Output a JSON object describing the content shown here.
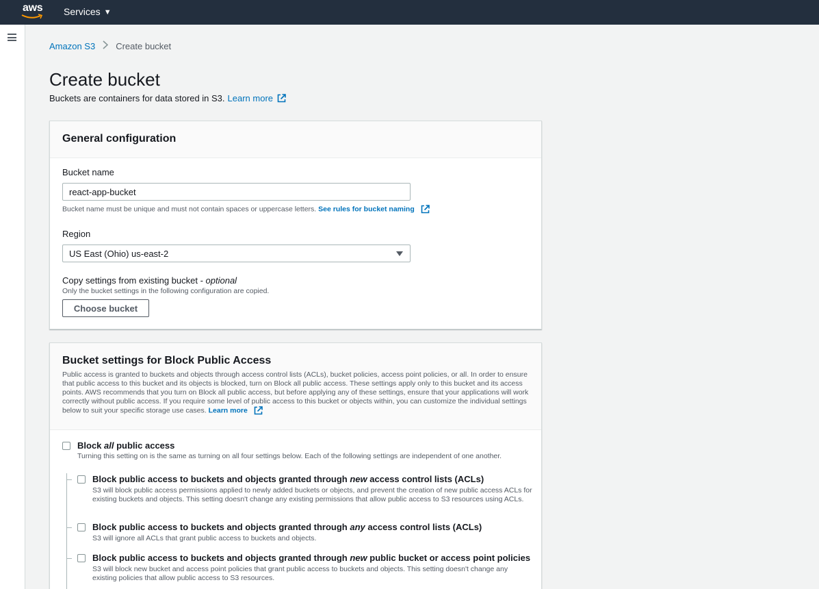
{
  "topbar": {
    "logo": "aws",
    "services_label": "Services"
  },
  "breadcrumb": {
    "root": "Amazon S3",
    "current": "Create bucket"
  },
  "page": {
    "title": "Create bucket",
    "description": "Buckets are containers for data stored in S3.",
    "learn_more": "Learn more"
  },
  "general": {
    "heading": "General configuration",
    "bucket_name_label": "Bucket name",
    "bucket_name_value": "react-app-bucket",
    "bucket_name_hint": "Bucket name must be unique and must not contain spaces or uppercase letters.",
    "bucket_name_rules_link": "See rules for bucket naming",
    "region_label": "Region",
    "region_value": "US East (Ohio) us-east-2",
    "copy_label": "Copy settings from existing bucket - ",
    "copy_optional": "optional",
    "copy_hint": "Only the bucket settings in the following configuration are copied.",
    "choose_bucket_button": "Choose bucket"
  },
  "block_public": {
    "heading": "Bucket settings for Block Public Access",
    "description": "Public access is granted to buckets and objects through access control lists (ACLs), bucket policies, access point policies, or all. In order to ensure that public access to this bucket and its objects is blocked, turn on Block all public access. These settings apply only to this bucket and its access points. AWS recommends that you turn on Block all public access, but before applying any of these settings, ensure that your applications will work correctly without public access. If you require some level of public access to this bucket or objects within, you can customize the individual settings below to suit your specific storage use cases.",
    "learn_more": "Learn more",
    "all": {
      "title_pre": "Block ",
      "title_em": "all",
      "title_post": " public access",
      "desc": "Turning this setting on is the same as turning on all four settings below. Each of the following settings are independent of one another.",
      "checked": false
    },
    "options": [
      {
        "title_pre": "Block public access to buckets and objects granted through ",
        "title_em": "new",
        "title_post": " access control lists (ACLs)",
        "desc": "S3 will block public access permissions applied to newly added buckets or objects, and prevent the creation of new public access ACLs for existing buckets and objects. This setting doesn't change any existing permissions that allow public access to S3 resources using ACLs.",
        "checked": false
      },
      {
        "title_pre": "Block public access to buckets and objects granted through ",
        "title_em": "any",
        "title_post": " access control lists (ACLs)",
        "desc": "S3 will ignore all ACLs that grant public access to buckets and objects.",
        "checked": false
      },
      {
        "title_pre": "Block public access to buckets and objects granted through ",
        "title_em": "new",
        "title_post": " public bucket or access point policies",
        "desc": "S3 will block new bucket and access point policies that grant public access to buckets and objects. This setting doesn't change any existing policies that allow public access to S3 resources.",
        "checked": false
      }
    ]
  },
  "colors": {
    "topbar": "#232f3e",
    "link": "#0073bb",
    "logo_smile": "#ff9900"
  }
}
